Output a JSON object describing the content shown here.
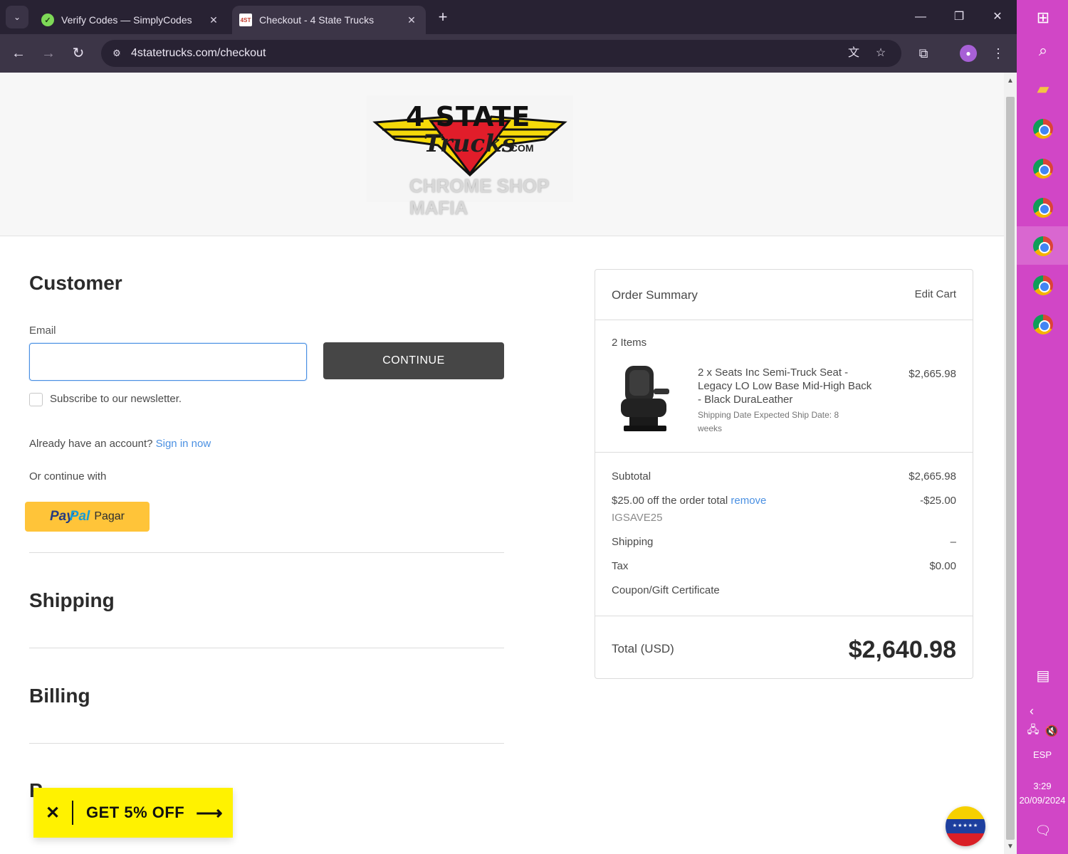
{
  "browser": {
    "tabs": [
      {
        "title": "Verify Codes — SimplyCodes",
        "favicon": "simplycodes-icon"
      },
      {
        "title": "Checkout - 4 State Trucks",
        "favicon": "4statetrucks-icon"
      }
    ],
    "url": "4statetrucks.com/checkout"
  },
  "logo": {
    "top": "4 STATE",
    "script": "Trucks",
    "com": ".COM",
    "sub": "CHROME SHOP MAFIA"
  },
  "customer": {
    "heading": "Customer",
    "email_label": "Email",
    "email_value": "",
    "continue_label": "CONTINUE",
    "newsletter_label": "Subscribe to our newsletter.",
    "account_prompt": "Already have an account?",
    "sign_in_link": "Sign in now",
    "or_continue": "Or continue with",
    "paypal": {
      "pay": "Pay",
      "pal": "Pal",
      "label": "Pagar"
    }
  },
  "sections": {
    "shipping": "Shipping",
    "billing": "Billing",
    "payment_partial": "P"
  },
  "order_summary": {
    "title": "Order Summary",
    "edit_cart": "Edit Cart",
    "items_count": "2 Items",
    "item": {
      "name": "2 x Seats Inc Semi-Truck Seat - Legacy LO Low Base Mid-High Back - Black DuraLeather",
      "note": "Shipping Date Expected Ship Date: 8 weeks",
      "price": "$2,665.98"
    },
    "subtotal_label": "Subtotal",
    "subtotal_value": "$2,665.98",
    "discount_label": "$25.00 off the order total",
    "discount_remove": "remove",
    "discount_value": "-$25.00",
    "discount_code": "IGSAVE25",
    "shipping_label": "Shipping",
    "shipping_value": "–",
    "tax_label": "Tax",
    "tax_value": "$0.00",
    "coupon_link": "Coupon/Gift Certificate",
    "total_label": "Total (USD)",
    "total_value": "$2,640.98"
  },
  "promo": {
    "label": "GET 5% OFF"
  },
  "taskbar": {
    "language": "ESP",
    "time": "3:29",
    "date": "20/09/2024"
  }
}
